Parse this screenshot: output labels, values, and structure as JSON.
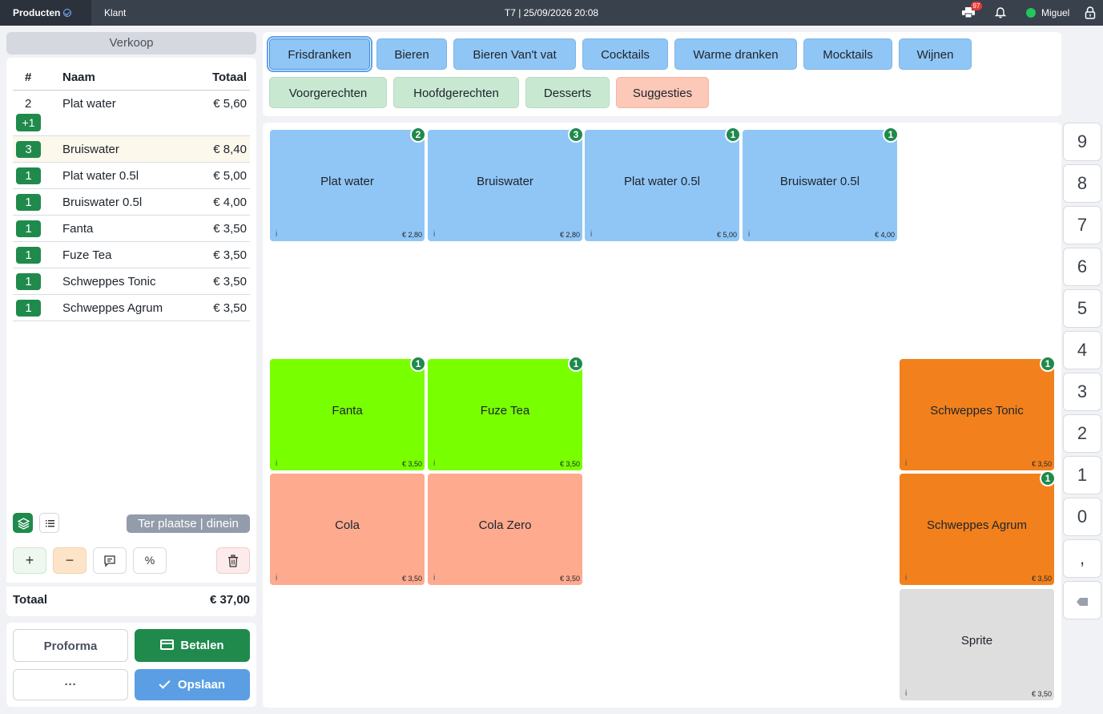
{
  "topbar": {
    "tab_producten": "Producten",
    "tab_klant": "Klant",
    "center_info": "T7 | 25/09/2026 20:08",
    "printer_badge": "97",
    "user": "Miguel"
  },
  "left": {
    "header": "Verkoop",
    "columns": {
      "num": "#",
      "naam": "Naam",
      "totaal": "Totaal"
    },
    "rows": [
      {
        "qty": "2",
        "name": "Plat water",
        "price": "€ 5,60",
        "extra": "+1"
      },
      {
        "qty": "3",
        "name": "Bruiswater",
        "price": "€ 8,40"
      },
      {
        "qty": "1",
        "name": "Plat water 0.5l",
        "price": "€ 5,00"
      },
      {
        "qty": "1",
        "name": "Bruiswater 0.5l",
        "price": "€ 4,00"
      },
      {
        "qty": "1",
        "name": "Fanta",
        "price": "€ 3,50"
      },
      {
        "qty": "1",
        "name": "Fuze Tea",
        "price": "€ 3,50"
      },
      {
        "qty": "1",
        "name": "Schweppes Tonic",
        "price": "€ 3,50"
      },
      {
        "qty": "1",
        "name": "Schweppes Agrum",
        "price": "€ 3,50"
      }
    ],
    "dinein_label": "Ter plaatse | dinein",
    "actions": {
      "plus": "+",
      "minus": "−",
      "percent": "%"
    },
    "totaal_label": "Totaal",
    "totaal_value": "€ 37,00",
    "proforma": "Proforma",
    "betalen": "Betalen",
    "more": "···",
    "opslaan": "Opslaan"
  },
  "categories": [
    {
      "label": "Frisdranken",
      "color": "blue",
      "active": true
    },
    {
      "label": "Bieren",
      "color": "blue"
    },
    {
      "label": "Bieren Van't vat",
      "color": "blue"
    },
    {
      "label": "Cocktails",
      "color": "blue"
    },
    {
      "label": "Warme dranken",
      "color": "blue"
    },
    {
      "label": "Mocktails",
      "color": "blue"
    },
    {
      "label": "Wijnen",
      "color": "blue"
    },
    {
      "label": "Voorgerechten",
      "color": "green"
    },
    {
      "label": "Hoofdgerechten",
      "color": "green"
    },
    {
      "label": "Desserts",
      "color": "green"
    },
    {
      "label": "Suggesties",
      "color": "salmon"
    }
  ],
  "products": [
    {
      "name": "Plat water",
      "price": "€ 2,80",
      "count": "2",
      "info": "i",
      "color": "#90c6f5"
    },
    {
      "name": "Bruiswater",
      "price": "€ 2,80",
      "count": "3",
      "info": "i",
      "color": "#90c6f5"
    },
    {
      "name": "Plat water 0.5l",
      "price": "€ 5,00",
      "count": "1",
      "info": "i",
      "color": "#90c6f5"
    },
    {
      "name": "Bruiswater 0.5l",
      "price": "€ 4,00",
      "count": "1",
      "info": "i",
      "color": "#90c6f5"
    },
    {
      "name": "Fanta",
      "price": "€ 3,50",
      "count": "1",
      "info": "i",
      "color": "#78ff00"
    },
    {
      "name": "Fuze Tea",
      "price": "€ 3,50",
      "count": "1",
      "info": "i",
      "color": "#78ff00"
    },
    {
      "name": "Schweppes Tonic",
      "price": "€ 3,50",
      "count": "1",
      "info": "i",
      "color": "#f2811d"
    },
    {
      "name": "Cola",
      "price": "€ 3,50",
      "info": "i",
      "color": "#fdaa8f"
    },
    {
      "name": "Cola Zero",
      "price": "€ 3,50",
      "info": "i",
      "color": "#fdaa8f"
    },
    {
      "name": "Schweppes Agrum",
      "price": "€ 3,50",
      "count": "1",
      "info": "i",
      "color": "#f2811d"
    },
    {
      "name": "Sprite",
      "price": "€ 3,50",
      "info": "i",
      "color": "#dedede"
    }
  ],
  "keypad": [
    "9",
    "8",
    "7",
    "6",
    "5",
    "4",
    "3",
    "2",
    "1",
    "0",
    ","
  ],
  "colors": {
    "green": "#1f8a4c",
    "blue_button": "#5b9ee3",
    "topbar": "#39414d"
  }
}
